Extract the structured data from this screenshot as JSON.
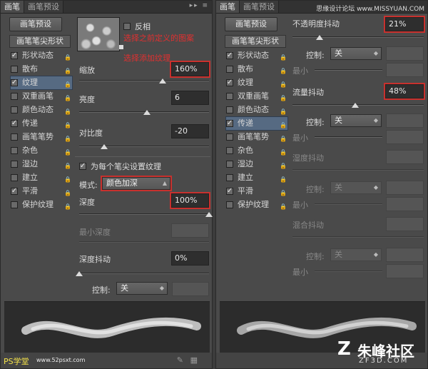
{
  "left_panel": {
    "tabs": [
      "画笔",
      "画笔预设"
    ],
    "preset_button": "画笔预设",
    "section_header": "画笔笔尖形状",
    "options": [
      {
        "label": "形状动态",
        "checked": true
      },
      {
        "label": "散布",
        "checked": false
      },
      {
        "label": "纹理",
        "checked": true,
        "selected": true
      },
      {
        "label": "双重画笔",
        "checked": false
      },
      {
        "label": "颜色动态",
        "checked": false
      },
      {
        "label": "传递",
        "checked": true
      },
      {
        "label": "画笔笔势",
        "checked": false
      },
      {
        "label": "杂色",
        "checked": false
      },
      {
        "label": "湿边",
        "checked": false
      },
      {
        "label": "建立",
        "checked": false
      },
      {
        "label": "平滑",
        "checked": true
      },
      {
        "label": "保护纹理",
        "checked": false
      }
    ],
    "invert_label": "反相",
    "annotation_1": "选择之前定义的图案",
    "annotation_2": "选择添加纹理",
    "scale_label": "缩放",
    "scale_value": "160%",
    "brightness_label": "亮度",
    "brightness_value": "6",
    "contrast_label": "对比度",
    "contrast_value": "-20",
    "per_tip_label": "为每个笔尖设置纹理",
    "mode_label": "模式:",
    "mode_value": "颜色加深",
    "depth_label": "深度",
    "depth_value": "100%",
    "min_depth_label": "最小深度",
    "depth_jitter_label": "深度抖动",
    "depth_jitter_value": "0%",
    "control_label": "控制:",
    "control_value": "关",
    "watermark": "PS学堂",
    "watermark_url": "www.52psxt.com"
  },
  "right_panel": {
    "tabs": [
      "画笔",
      "画笔预设"
    ],
    "preset_button": "画笔预设",
    "section_header": "画笔笔尖形状",
    "options": [
      {
        "label": "形状动态",
        "checked": true
      },
      {
        "label": "散布",
        "checked": false
      },
      {
        "label": "纹理",
        "checked": true
      },
      {
        "label": "双重画笔",
        "checked": false
      },
      {
        "label": "颜色动态",
        "checked": false
      },
      {
        "label": "传递",
        "checked": true,
        "selected": true
      },
      {
        "label": "画笔笔势",
        "checked": false
      },
      {
        "label": "杂色",
        "checked": false
      },
      {
        "label": "湿边",
        "checked": false
      },
      {
        "label": "建立",
        "checked": false
      },
      {
        "label": "平滑",
        "checked": true
      },
      {
        "label": "保护纹理",
        "checked": false
      }
    ],
    "opacity_jitter_label": "不透明度抖动",
    "opacity_jitter_value": "21%",
    "control_label": "控制:",
    "control_value": "关",
    "min_label": "最小",
    "flow_jitter_label": "流量抖动",
    "flow_jitter_value": "48%",
    "wetness_jitter_label": "湿度抖动",
    "mix_jitter_label": "混合抖动",
    "top_watermark": "思缘设计论坛  www.MISSYUAN.COM",
    "logo_text": "朱峰社区",
    "logo_url": "ZF3D.COM"
  }
}
